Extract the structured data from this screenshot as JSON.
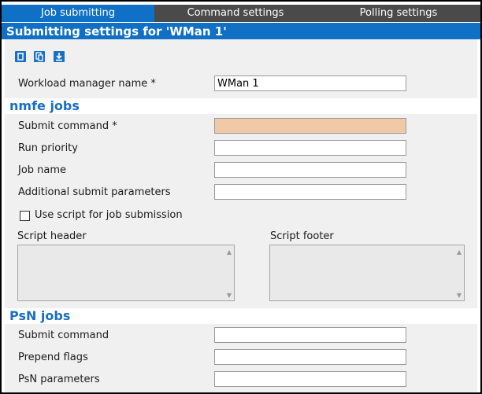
{
  "tabs": [
    {
      "label": "Job submitting",
      "active": true
    },
    {
      "label": "Command settings",
      "active": false
    },
    {
      "label": "Polling settings",
      "active": false
    }
  ],
  "title": "Submitting settings for 'WMan 1'",
  "toolbar": [
    "delete-icon",
    "copy-icon",
    "download-icon"
  ],
  "workload": {
    "label": "Workload manager name *",
    "value": "WMan 1"
  },
  "nmfe": {
    "heading": "nmfe jobs",
    "fields": [
      {
        "label": "Submit command *",
        "value": ""
      },
      {
        "label": "Run priority",
        "value": ""
      },
      {
        "label": "Job name",
        "value": ""
      },
      {
        "label": "Additional submit parameters",
        "value": ""
      }
    ],
    "use_script_label": "Use script for job submission",
    "use_script_checked": false,
    "script_header_label": "Script header",
    "script_footer_label": "Script footer"
  },
  "psn": {
    "heading": "PsN jobs",
    "fields": [
      {
        "label": "Submit command",
        "value": ""
      },
      {
        "label": "Prepend flags",
        "value": ""
      },
      {
        "label": "PsN parameters",
        "value": ""
      }
    ]
  },
  "colors": {
    "accent": "#0f70c6",
    "tab_inactive": "#4a4a4a",
    "required_empty": "#f1c9a6"
  }
}
